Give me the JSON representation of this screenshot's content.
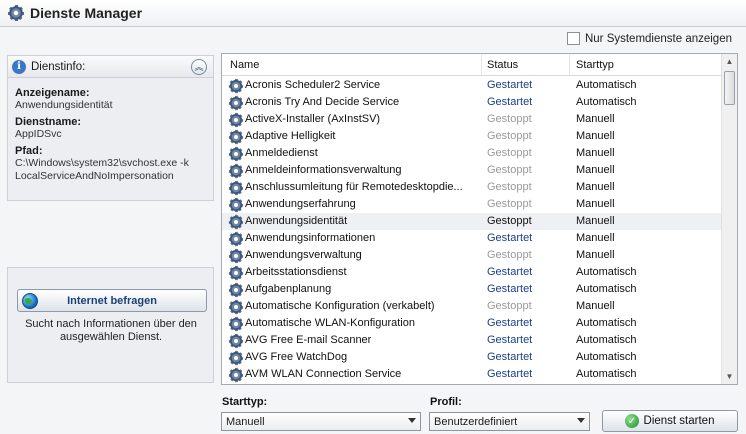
{
  "window": {
    "title": "Dienste Manager"
  },
  "filter": {
    "label": "Nur Systemdienste anzeigen",
    "checked": false
  },
  "info": {
    "title": "Dienstinfo:",
    "display_name_label": "Anzeigename:",
    "display_name": "Anwendungsidentität",
    "service_name_label": "Dienstname:",
    "service_name": "AppIDSvc",
    "path_label": "Pfad:",
    "path_line1": "C:\\Windows\\system32\\svchost.exe -k",
    "path_line2": "LocalServiceAndNoImpersonation"
  },
  "query": {
    "button_label": "Internet befragen",
    "description": "Sucht nach Informationen über den ausgewählen Dienst."
  },
  "table": {
    "columns": [
      "Name",
      "Status",
      "Starttyp"
    ],
    "rows": [
      {
        "name": "Acronis Scheduler2 Service",
        "status": "Gestartet",
        "start": "Automatisch"
      },
      {
        "name": "Acronis Try And Decide Service",
        "status": "Gestartet",
        "start": "Automatisch"
      },
      {
        "name": "ActiveX-Installer (AxInstSV)",
        "status": "Gestoppt",
        "start": "Manuell"
      },
      {
        "name": "Adaptive Helligkeit",
        "status": "Gestoppt",
        "start": "Manuell"
      },
      {
        "name": "Anmeldedienst",
        "status": "Gestoppt",
        "start": "Manuell"
      },
      {
        "name": "Anmeldeinformationsverwaltung",
        "status": "Gestoppt",
        "start": "Manuell"
      },
      {
        "name": "Anschlussumleitung für Remotedesktopdie...",
        "status": "Gestoppt",
        "start": "Manuell"
      },
      {
        "name": "Anwendungserfahrung",
        "status": "Gestoppt",
        "start": "Manuell"
      },
      {
        "name": "Anwendungsidentität",
        "status": "Gestoppt",
        "start": "Manuell",
        "selected": true
      },
      {
        "name": "Anwendungsinformationen",
        "status": "Gestartet",
        "start": "Manuell"
      },
      {
        "name": "Anwendungsverwaltung",
        "status": "Gestoppt",
        "start": "Manuell"
      },
      {
        "name": "Arbeitsstationsdienst",
        "status": "Gestartet",
        "start": "Automatisch"
      },
      {
        "name": "Aufgabenplanung",
        "status": "Gestartet",
        "start": "Automatisch"
      },
      {
        "name": "Automatische Konfiguration (verkabelt)",
        "status": "Gestoppt",
        "start": "Manuell"
      },
      {
        "name": "Automatische WLAN-Konfiguration",
        "status": "Gestartet",
        "start": "Automatisch"
      },
      {
        "name": "AVG Free E-mail Scanner",
        "status": "Gestartet",
        "start": "Automatisch"
      },
      {
        "name": "AVG Free WatchDog",
        "status": "Gestartet",
        "start": "Automatisch"
      },
      {
        "name": "AVM WLAN Connection Service",
        "status": "Gestartet",
        "start": "Automatisch"
      }
    ]
  },
  "controls": {
    "starttype_label": "Starttyp:",
    "starttype_value": "Manuell",
    "profile_label": "Profil:",
    "profile_value": "Benutzerdefiniert",
    "start_button": "Dienst starten"
  },
  "colors": {
    "running": "#1b3f8a",
    "stopped": "#9a9a9a"
  },
  "icons": [
    "gear-icon",
    "info-icon",
    "collapse-icon",
    "globe-icon",
    "check-icon"
  ]
}
